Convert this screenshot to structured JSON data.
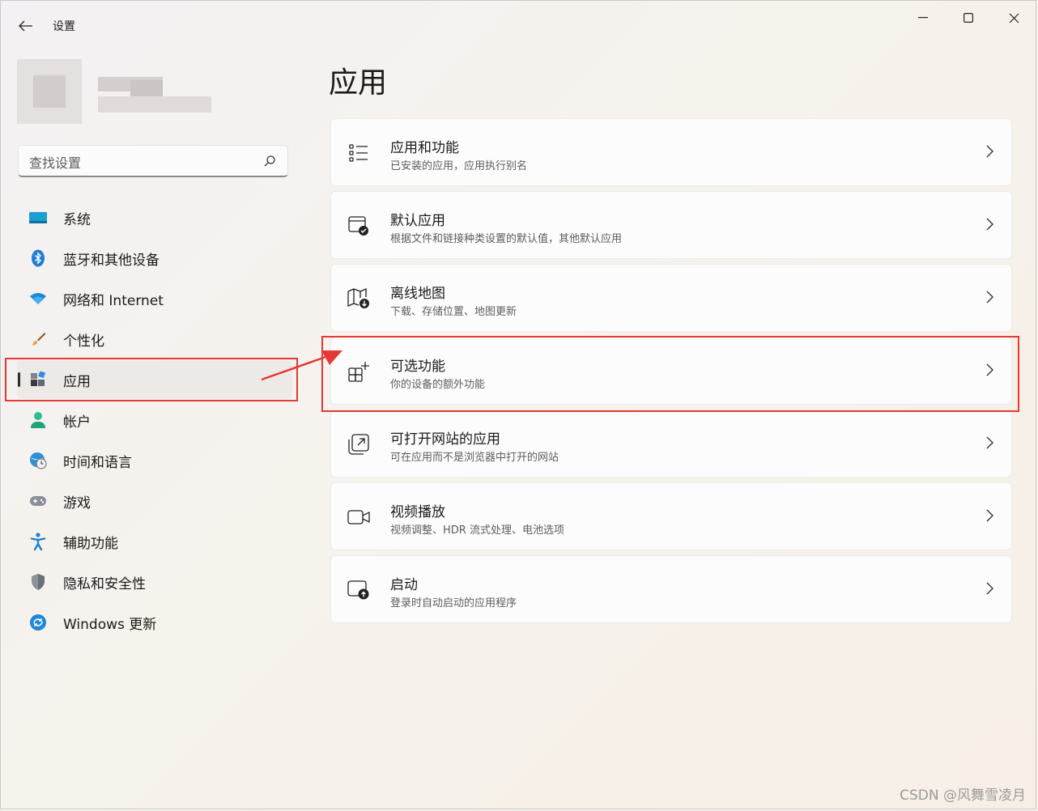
{
  "window": {
    "title": "设置"
  },
  "search": {
    "placeholder": "查找设置"
  },
  "sidebar": {
    "items": [
      {
        "label": "系统",
        "icon": "monitor-icon"
      },
      {
        "label": "蓝牙和其他设备",
        "icon": "bluetooth-icon"
      },
      {
        "label": "网络和 Internet",
        "icon": "wifi-icon"
      },
      {
        "label": "个性化",
        "icon": "brush-icon"
      },
      {
        "label": "应用",
        "icon": "apps-icon",
        "selected": true
      },
      {
        "label": "帐户",
        "icon": "person-icon"
      },
      {
        "label": "时间和语言",
        "icon": "globe-clock-icon"
      },
      {
        "label": "游戏",
        "icon": "gamepad-icon"
      },
      {
        "label": "辅助功能",
        "icon": "accessibility-icon"
      },
      {
        "label": "隐私和安全性",
        "icon": "shield-icon"
      },
      {
        "label": "Windows 更新",
        "icon": "update-icon"
      }
    ]
  },
  "main": {
    "title": "应用",
    "cards": [
      {
        "title": "应用和功能",
        "subtitle": "已安装的应用，应用执行别名",
        "icon": "list-icon"
      },
      {
        "title": "默认应用",
        "subtitle": "根据文件和链接种类设置的默认值，其他默认应用",
        "icon": "default-app-icon"
      },
      {
        "title": "离线地图",
        "subtitle": "下载、存储位置、地图更新",
        "icon": "map-download-icon"
      },
      {
        "title": "可选功能",
        "subtitle": "你的设备的额外功能",
        "icon": "add-feature-icon"
      },
      {
        "title": "可打开网站的应用",
        "subtitle": "可在应用而不是浏览器中打开的网站",
        "icon": "open-external-icon"
      },
      {
        "title": "视频播放",
        "subtitle": "视频调整、HDR 流式处理、电池选项",
        "icon": "video-icon"
      },
      {
        "title": "启动",
        "subtitle": "登录时自动启动的应用程序",
        "icon": "startup-icon"
      }
    ]
  },
  "colors": {
    "annotation": "#e53935",
    "accent": "#0067c0"
  },
  "watermark": "CSDN @风舞雪凌月"
}
